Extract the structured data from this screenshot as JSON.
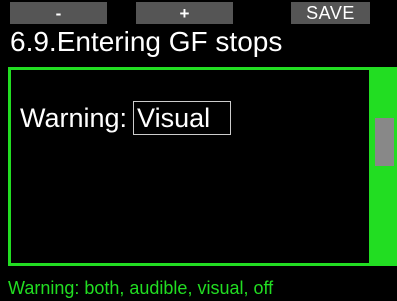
{
  "softkeys": {
    "minus_label": "-",
    "plus_label": "+",
    "save_label": "SAVE"
  },
  "title": "6.9.Entering GF stops",
  "setting": {
    "label": "Warning:",
    "value": "Visual"
  },
  "footer": "Warning: both, audible, visual, off",
  "colors": {
    "accent": "#22dd22",
    "softkey_bg": "#555555",
    "scroll_thumb": "#888888",
    "background": "#000000"
  }
}
